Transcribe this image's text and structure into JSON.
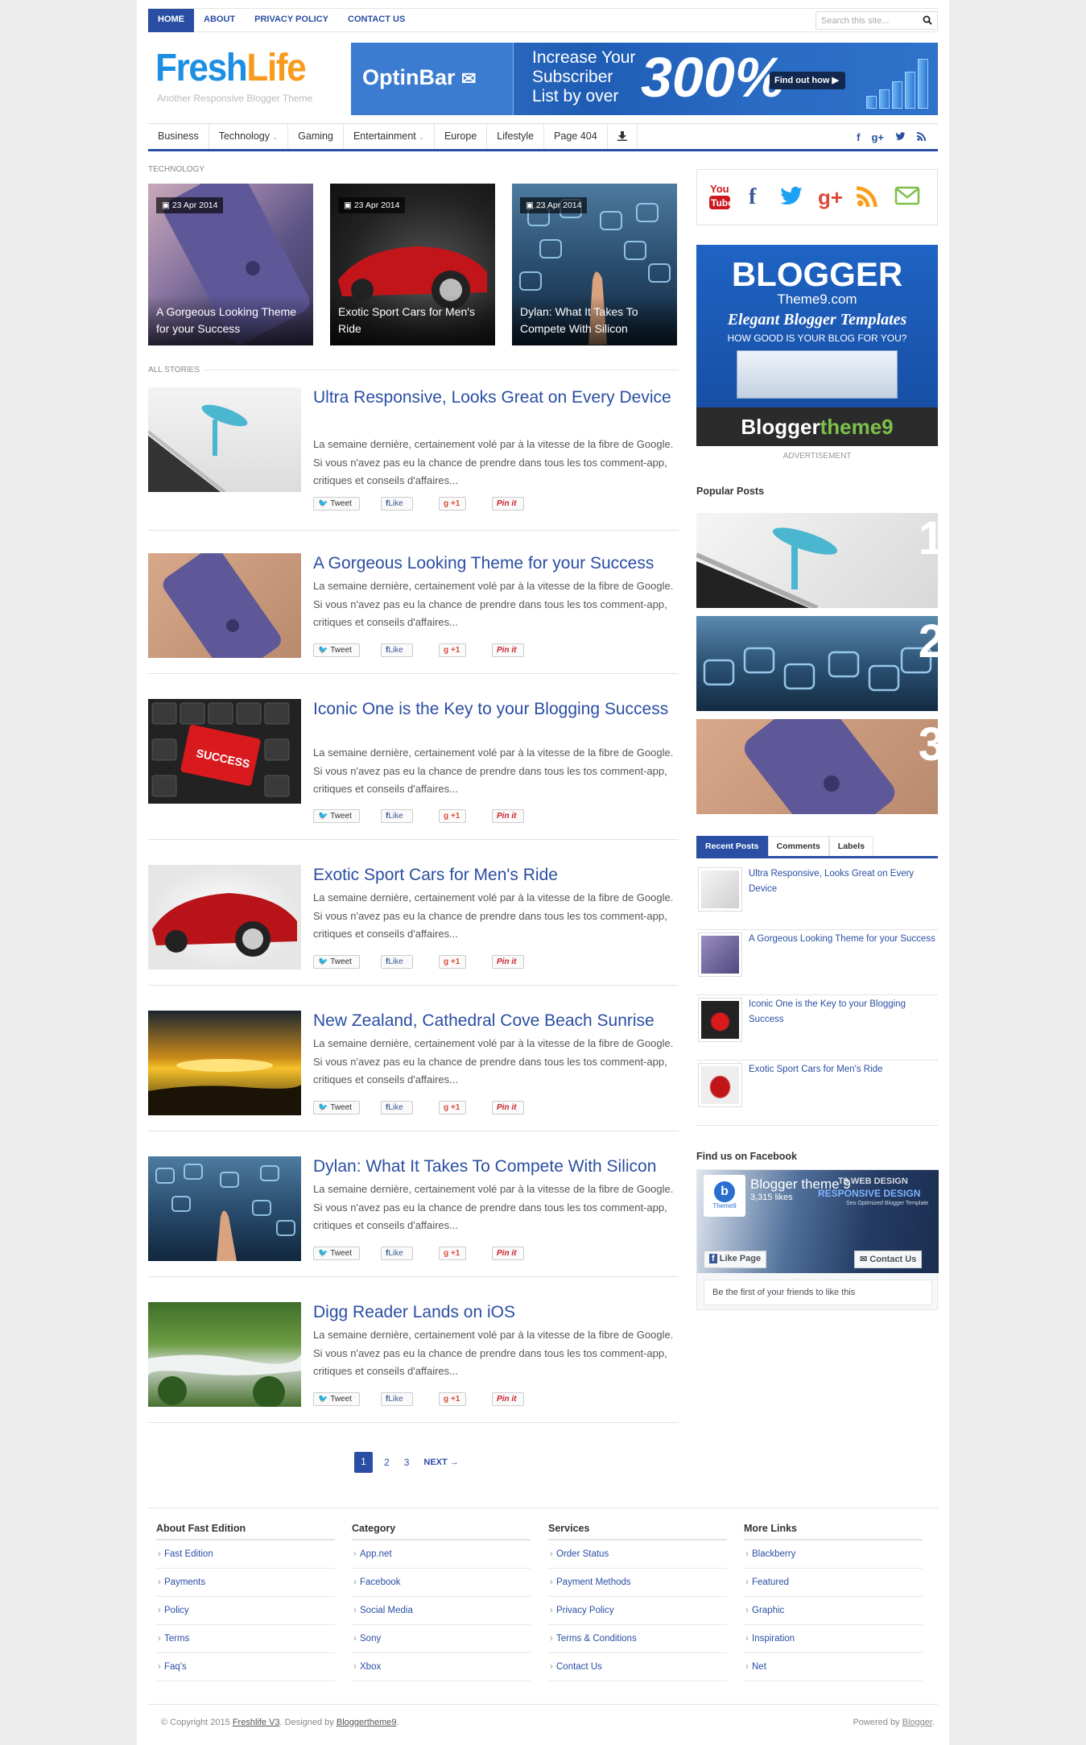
{
  "topnav": {
    "items": [
      "Home",
      "About",
      "Privacy Policy",
      "Contact Us"
    ],
    "search_placeholder": "Search this site..."
  },
  "header": {
    "logo_part1": "Fresh",
    "logo_part2": "Life",
    "tagline": "Another Responsive Blogger Theme",
    "banner": {
      "brand": "OptinBar",
      "line1": "Increase Your",
      "line2": "Subscriber",
      "line3": "List by over",
      "big": "300%",
      "cta": "Find out how"
    }
  },
  "mainnav": {
    "items": [
      "Business",
      "Technology",
      "Gaming",
      "Entertainment",
      "Europe",
      "Lifestyle",
      "Page 404"
    ],
    "dropdown_caret": "⌄"
  },
  "sections": {
    "technology": "Technology",
    "all_stories": "All Stories"
  },
  "featured": [
    {
      "date": "23 Apr 2014",
      "title": "A Gorgeous Looking Theme for your Success"
    },
    {
      "date": "23 Apr 2014",
      "title": "Exotic Sport Cars for Men's Ride"
    },
    {
      "date": "23 Apr 2014",
      "title": "Dylan: What It Takes To Compete With Silicon"
    }
  ],
  "stories": [
    {
      "title": "Ultra Responsive, Looks Great on Every Device",
      "excerpt": "La semaine dernière, certainement volé par à la vitesse de la fibre de Google. Si vous n'avez pas eu la chance de prendre dans tous les tos comment-app, critiques et conseils d'affaires..."
    },
    {
      "title": "A Gorgeous Looking Theme for your Success",
      "excerpt": "La semaine dernière, certainement volé par à la vitesse de la fibre de Google. Si vous n'avez pas eu la chance de prendre dans tous les tos comment-app, critiques et conseils d'affaires..."
    },
    {
      "title": "Iconic One is the Key to your Blogging Success",
      "excerpt": "La semaine dernière, certainement volé par à la vitesse de la fibre de Google. Si vous n'avez pas eu la chance de prendre dans tous les tos comment-app, critiques et conseils d'affaires..."
    },
    {
      "title": "Exotic Sport Cars for Men's Ride",
      "excerpt": "La semaine dernière, certainement volé par à la vitesse de la fibre de Google. Si vous n'avez pas eu la chance de prendre dans tous les tos comment-app, critiques et conseils d'affaires..."
    },
    {
      "title": "New Zealand, Cathedral Cove Beach Sunrise",
      "excerpt": "La semaine dernière, certainement volé par à la vitesse de la fibre de Google. Si vous n'avez pas eu la chance de prendre dans tous les tos comment-app, critiques et conseils d'affaires..."
    },
    {
      "title": "Dylan: What It Takes To Compete With Silicon",
      "excerpt": "La semaine dernière, certainement volé par à la vitesse de la fibre de Google. Si vous n'avez pas eu la chance de prendre dans tous les tos comment-app, critiques et conseils d'affaires..."
    },
    {
      "title": "Digg Reader Lands on iOS",
      "excerpt": "La semaine dernière, certainement volé par à la vitesse de la fibre de Google. Si vous n'avez pas eu la chance de prendre dans tous les tos comment-app, critiques et conseils d'affaires..."
    }
  ],
  "share": {
    "tweet": "Tweet",
    "like": "Like",
    "plus": "+1",
    "pin": "Pin it"
  },
  "pager": {
    "pages": [
      "1",
      "2",
      "3"
    ],
    "next": "NEXT →"
  },
  "sidebar": {
    "ad": {
      "title": "BLOGGER",
      "sub": "Theme9.com",
      "script": "Elegant Blogger Templates",
      "question": "HOW GOOD IS YOUR BLOG FOR YOU?",
      "brand1": "Blogger",
      "brand2": "theme9"
    },
    "ad_label": "Advertisement",
    "popular_title": "Popular Posts",
    "popular_nums": [
      "1",
      "2",
      "3"
    ],
    "tabs": [
      "Recent Posts",
      "Comments",
      "Labels"
    ],
    "recent": [
      "Ultra Responsive, Looks Great on Every Device",
      "A Gorgeous Looking Theme for your Success",
      "Iconic One is the Key to your Blogging Success",
      "Exotic Sport Cars for Men's Ride"
    ],
    "facebook_title": "Find us on Facebook",
    "facebook": {
      "page": "Blogger theme 9",
      "likes": "3,315 likes",
      "like_btn": "Like Page",
      "contact_btn": "Contact Us",
      "friends": "Be the first of your friends to like this",
      "cover1": "T9 WEB DESIGN",
      "cover2": "RESPONSIVE DESIGN",
      "cover3": "Seo Optimized Blogger Template",
      "avatar": "Theme9"
    }
  },
  "footer": {
    "cols": [
      {
        "title": "About Fast Edition",
        "items": [
          "Fast Edition",
          "Payments",
          "Policy",
          "Terms",
          "Faq's"
        ]
      },
      {
        "title": "Category",
        "items": [
          "App.net",
          "Facebook",
          "Social Media",
          "Sony",
          "Xbox"
        ]
      },
      {
        "title": "Services",
        "items": [
          "Order Status",
          "Payment Methods",
          "Privacy Policy",
          "Terms & Conditions",
          "Contact Us"
        ]
      },
      {
        "title": "More Links",
        "items": [
          "Blackberry",
          "Featured",
          "Graphic",
          "Inspiration",
          "Net"
        ]
      }
    ],
    "copy_pre": "© Copyright 2015",
    "copy_name": "Freshlife V3",
    "copy_mid": ". Designed by",
    "copy_designer": "Bloggertheme9",
    "powered_pre": "Powered by",
    "powered_name": "Blogger"
  },
  "colors": {
    "accent": "#2a4ea3",
    "logo_blue": "#1d8fe3",
    "logo_orange": "#f89a1c"
  }
}
